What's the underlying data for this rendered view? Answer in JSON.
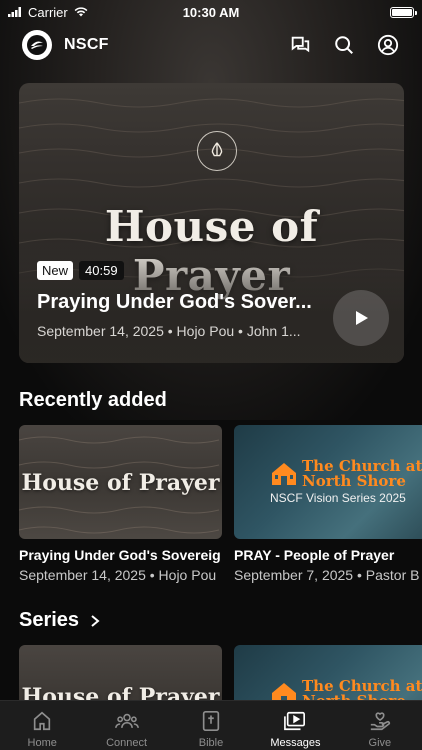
{
  "status_bar": {
    "carrier": "Carrier",
    "time": "10:30 AM"
  },
  "header": {
    "brand": "NSCF",
    "icons": [
      "chat-icon",
      "search-icon",
      "profile-icon"
    ]
  },
  "hero": {
    "art_title": "House of Prayer",
    "badge_new": "New",
    "duration": "40:59",
    "title": "Praying Under God's Sover...",
    "meta": "September 14, 2025 • Hojo Pou • John 1..."
  },
  "recently_added": {
    "heading": "Recently added",
    "items": [
      {
        "art": "House of Prayer",
        "title": "Praying Under God's Sovereig",
        "meta": "September 14, 2025 • Hojo Pou"
      },
      {
        "art_line1": "The Church at",
        "art_line2": "North Shore",
        "art_sub": "NSCF Vision Series 2025",
        "title": "PRAY - People of Prayer",
        "meta": "September 7, 2025 • Pastor B"
      }
    ]
  },
  "series": {
    "heading": "Series",
    "items": [
      {
        "art": "House of Prayer"
      },
      {
        "art_line1": "The Church at",
        "art_line2": "North Shore"
      }
    ]
  },
  "tabs": [
    {
      "label": "Home",
      "icon": "home-icon",
      "active": false
    },
    {
      "label": "Connect",
      "icon": "people-icon",
      "active": false
    },
    {
      "label": "Bible",
      "icon": "bible-icon",
      "active": false
    },
    {
      "label": "Messages",
      "icon": "messages-icon",
      "active": true
    },
    {
      "label": "Give",
      "icon": "give-icon",
      "active": false
    }
  ],
  "colors": {
    "accent": "#ff8a1f",
    "background": "#0b0b0b",
    "tab_bar": "#1d1d1d"
  }
}
